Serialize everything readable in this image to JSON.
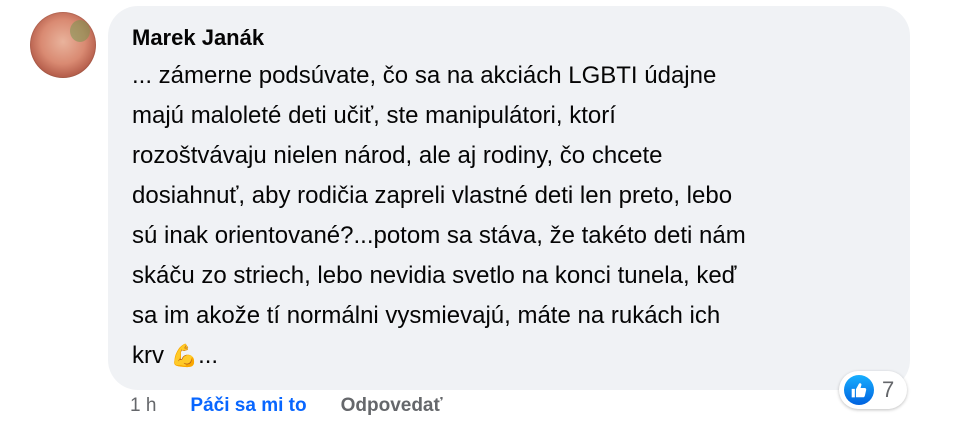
{
  "comment": {
    "author": "Marek Janák",
    "lines": [
      "... zámerne podsúvate, čo sa na akciách LGBTI údajne",
      "majú maloleté deti učiť, ste manipulátori, ktorí",
      "rozoštvávaju nielen národ, ale aj rodiny, čo chcete",
      "dosiahnuť, aby rodičia zapreli vlastné deti len preto, lebo",
      "sú inak orientované?...potom sa stáva, že takéto deti nám",
      "skáču zo striech, lebo nevidia svetlo na konci tunela, keď",
      "sa im akože tí normálni vysmievajú, máte na rukách ich"
    ],
    "last_line_text": "krv",
    "last_line_emoji": "💪",
    "last_line_suffix": "...",
    "reaction_count": "7",
    "reaction_icon": "like-icon"
  },
  "actions": {
    "time": "1 h",
    "like_label": "Páči sa mi to",
    "reply_label": "Odpovedať"
  },
  "colors": {
    "bubble_bg": "#f0f2f5",
    "like_blue": "#0866ff",
    "muted": "#65676b"
  }
}
